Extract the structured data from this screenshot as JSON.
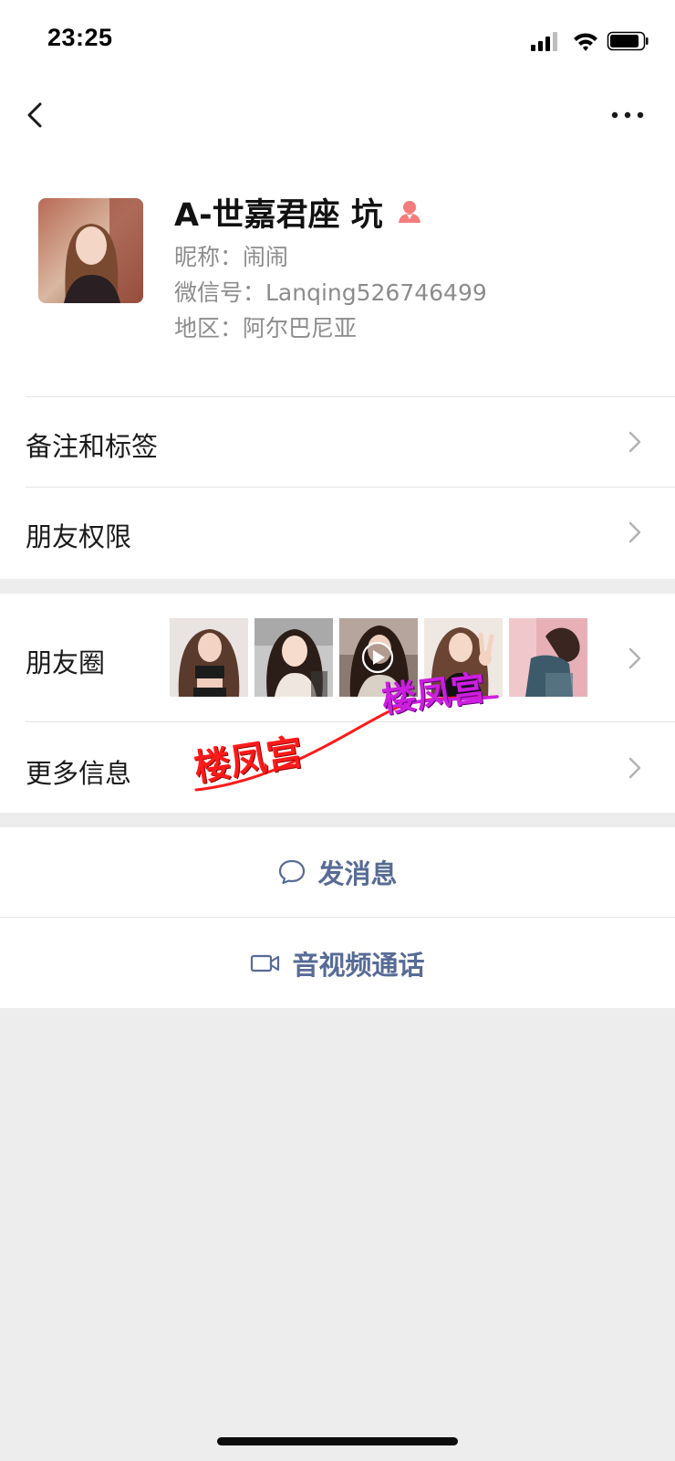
{
  "status_bar": {
    "time": "23:25"
  },
  "profile": {
    "name": "A-世嘉君座 坑",
    "nickname_line": "昵称：闹闹",
    "wechat_id_line": "微信号：Lanqing526746499",
    "region_line": "地区：阿尔巴尼亚",
    "gender_icon": "female-person-icon"
  },
  "menu": {
    "remark_tags": "备注和标签",
    "friend_permissions": "朋友权限",
    "moments": "朋友圈",
    "more_info": "更多信息"
  },
  "moments_thumbnails": [
    {
      "name": "moments-photo-1",
      "has_play": false
    },
    {
      "name": "moments-photo-2",
      "has_play": false
    },
    {
      "name": "moments-photo-3",
      "has_play": true
    },
    {
      "name": "moments-photo-4",
      "has_play": false
    },
    {
      "name": "moments-photo-5",
      "has_play": false
    }
  ],
  "actions": {
    "send_message": "发消息",
    "av_call": "音视频通话"
  },
  "watermark": {
    "text_upper": "楼凤宫",
    "text_lower": "楼凤宫"
  },
  "colors": {
    "link_blue": "#576b95",
    "background_gray": "#ededed",
    "watermark_red": "#ff1a1a",
    "watermark_purple": "#cc1fe0"
  }
}
